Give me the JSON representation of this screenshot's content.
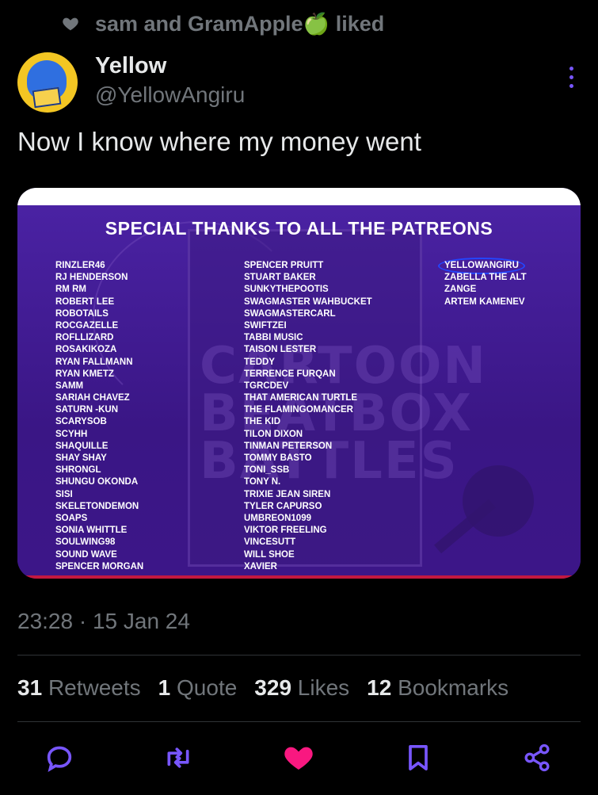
{
  "social_context": {
    "text": "sam and GramApple",
    "emoji": "🍏",
    "suffix": "liked"
  },
  "author": {
    "display_name": "Yellow",
    "handle": "@YellowAngiru"
  },
  "tweet": {
    "text": "Now I know where my money went"
  },
  "media": {
    "heading": "SPECIAL THANKS TO ALL THE PATREONS",
    "watermark": [
      "CARTOON",
      "BEATBOX",
      "BATTLES"
    ],
    "column1": [
      "RINZLER46",
      "RJ HENDERSON",
      "RM RM",
      "ROBERT LEE",
      "ROBOTAILS",
      "ROCGAZELLE",
      "ROFLLIZARD",
      "ROSAKIKOZA",
      "RYAN FALLMANN",
      "RYAN KMETZ",
      "SAMM",
      "SARIAH CHAVEZ",
      "SATURN -KUN",
      "SCARYSOB",
      "SCYHH",
      "SHAQUILLE",
      "SHAY SHAY",
      "SHRONGL",
      "SHUNGU OKONDA",
      "SISI",
      "SKELETONDEMON",
      "SOAPS",
      "SONIA WHITTLE",
      "SOULWING98",
      "SOUND WAVE",
      "SPENCER MORGAN"
    ],
    "column2": [
      "SPENCER PRUITT",
      "STUART BAKER",
      "SUNKYTHEPOOTIS",
      "SWAGMASTER WAHBUCKET",
      "SWAGMASTERCARL",
      "SWIFTZEI",
      "TABBI MUSIC",
      "TAISON LESTER",
      "TEDDY",
      "TERRENCE FURQAN",
      "TGRCDEV",
      "THAT AMERICAN TURTLE",
      "THE FLAMINGOMANCER",
      "THE KID",
      "TILON DIXON",
      "TINMAN PETERSON",
      "TOMMY BASTO",
      "TONI_SSB",
      "TONY N.",
      "TRIXIE JEAN SIREN",
      "TYLER CAPURSO",
      "UMBREON1099",
      "VIKTOR FREELING",
      "VINCESUTT",
      "WILL SHOE",
      "XAVIER"
    ],
    "column3": [
      "YELLOWANGIRU",
      "ZABELLA THE ALT",
      "ZANGE",
      "ARTEM KAMENEV"
    ]
  },
  "timestamp": "23:28 · 15 Jan 24",
  "stats": {
    "retweets": {
      "count": "31",
      "label": "Retweets"
    },
    "quotes": {
      "count": "1",
      "label": "Quote"
    },
    "likes": {
      "count": "329",
      "label": "Likes"
    },
    "bookmarks": {
      "count": "12",
      "label": "Bookmarks"
    }
  },
  "colors": {
    "like": "#f91880",
    "accent": "#7856ff",
    "muted": "#71767b"
  },
  "icons": [
    "heart-icon",
    "reply-icon",
    "retweet-icon",
    "like-icon",
    "bookmark-icon",
    "share-icon",
    "more-icon"
  ]
}
